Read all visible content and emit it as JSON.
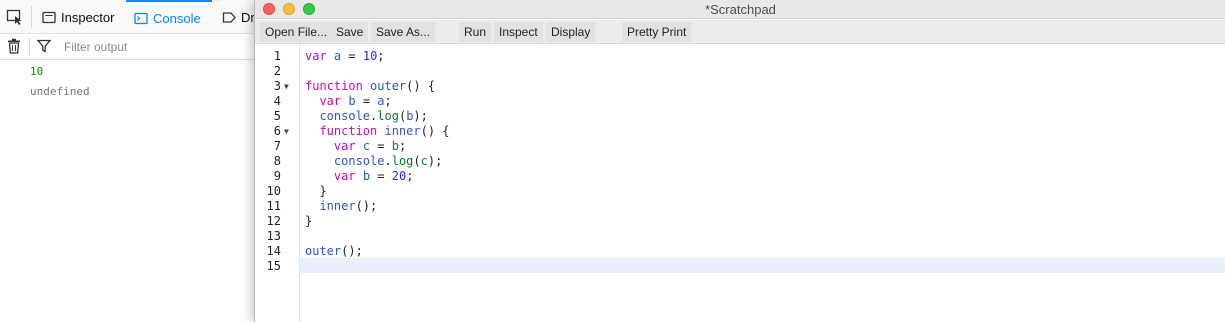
{
  "devtools": {
    "tabs": [
      {
        "label": "Inspector"
      },
      {
        "label": "Console"
      },
      {
        "label": "Dr"
      }
    ],
    "filter_placeholder": "Filter output",
    "console_output": [
      "10",
      "undefined"
    ]
  },
  "scratchpad": {
    "title": "*Scratchpad",
    "toolbar": {
      "open_file": "Open File...",
      "save": "Save",
      "save_as": "Save As...",
      "run": "Run",
      "inspect": "Inspect",
      "display": "Display",
      "pretty_print": "Pretty Print"
    },
    "current_line": 15,
    "code_lines": [
      {
        "n": "1",
        "fold": false,
        "src": "var a = 10;"
      },
      {
        "n": "2",
        "fold": false,
        "src": ""
      },
      {
        "n": "3",
        "fold": true,
        "src": "function outer() {"
      },
      {
        "n": "4",
        "fold": false,
        "src": "  var b = a;"
      },
      {
        "n": "5",
        "fold": false,
        "src": "  console.log(b);"
      },
      {
        "n": "6",
        "fold": true,
        "src": "  function inner() {"
      },
      {
        "n": "7",
        "fold": false,
        "src": "    var c = b;"
      },
      {
        "n": "8",
        "fold": false,
        "src": "    console.log(c);"
      },
      {
        "n": "9",
        "fold": false,
        "src": "    var b = 20;"
      },
      {
        "n": "10",
        "fold": false,
        "src": "  }"
      },
      {
        "n": "11",
        "fold": false,
        "src": "  inner();"
      },
      {
        "n": "12",
        "fold": false,
        "src": "}"
      },
      {
        "n": "13",
        "fold": false,
        "src": ""
      },
      {
        "n": "14",
        "fold": false,
        "src": "outer();"
      },
      {
        "n": "15",
        "fold": false,
        "src": ""
      }
    ]
  },
  "colors": {
    "keyword": "#c00db6",
    "identifier": "#2f56c7",
    "number": "#2626ff",
    "method": "#0a7a35",
    "console_tab_accent": "#0a84ff",
    "console_number_output": "#058b00",
    "current_line_bg": "#e8f1fb"
  },
  "icons": [
    "element-picker-icon",
    "inspector-icon",
    "console-icon",
    "debugger-icon",
    "trash-icon",
    "filter-icon",
    "fold-arrow-icon"
  ]
}
